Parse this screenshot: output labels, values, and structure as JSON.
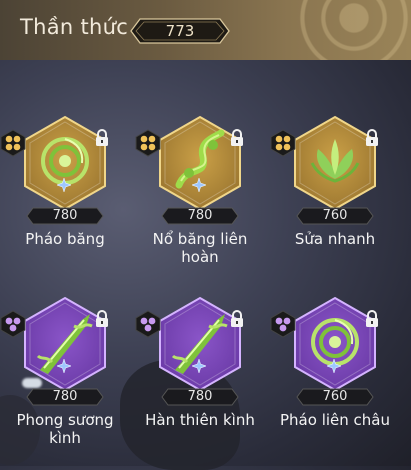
{
  "header": {
    "title": "Thần thức",
    "counter_value": "773"
  },
  "colors": {
    "gold_hex": "#c9a04a",
    "purple_hex": "#8f5bd1",
    "header_bg": "#6b5b41"
  },
  "items": [
    {
      "label": "Pháo băng",
      "value": "780",
      "tier": "gold",
      "art": "spiral-coil"
    },
    {
      "label": "Nổ băng liên hoàn",
      "value": "780",
      "tier": "gold",
      "art": "twisted-vine"
    },
    {
      "label": "Sửa nhanh",
      "value": "760",
      "tier": "gold",
      "art": "lotus-flower"
    },
    {
      "label": "Phong sương kình",
      "value": "780",
      "tier": "purple",
      "art": "green-blade"
    },
    {
      "label": "Hàn thiên kình",
      "value": "780",
      "tier": "purple",
      "art": "green-blade"
    },
    {
      "label": "Pháo liên châu",
      "value": "760",
      "tier": "purple",
      "art": "spiral-coil"
    }
  ]
}
